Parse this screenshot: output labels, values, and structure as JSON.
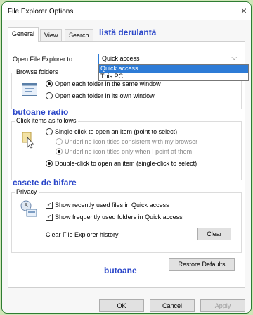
{
  "window": {
    "title": "File Explorer Options",
    "close_glyph": "×"
  },
  "tabs": [
    {
      "label": "General"
    },
    {
      "label": "View"
    },
    {
      "label": "Search"
    }
  ],
  "annotations": {
    "dropdown": "listă derulantă",
    "radios": "butoane radio",
    "checkboxes": "casete de bifare",
    "buttons": "butoane"
  },
  "open_explorer": {
    "label": "Open File Explorer to:",
    "value": "Quick access",
    "options": [
      "Quick access",
      "This PC"
    ]
  },
  "browse_folders": {
    "title": "Browse folders",
    "options": [
      {
        "label": "Open each folder in the same window",
        "selected": true
      },
      {
        "label": "Open each folder in its own window",
        "selected": false
      }
    ]
  },
  "click_items": {
    "title": "Click items as follows",
    "single": "Single-click to open an item (point to select)",
    "underline_consistent": "Underline icon titles consistent with my browser",
    "underline_point": "Underline icon titles only when I point at them",
    "double": "Double-click to open an item (single-click to select)"
  },
  "privacy": {
    "title": "Privacy",
    "recent_files": "Show recently used files in Quick access",
    "frequent_folders": "Show frequently used folders in Quick access",
    "clear_label": "Clear File Explorer history",
    "clear_button": "Clear"
  },
  "buttons": {
    "restore": "Restore Defaults",
    "ok": "OK",
    "cancel": "Cancel",
    "apply": "Apply"
  }
}
